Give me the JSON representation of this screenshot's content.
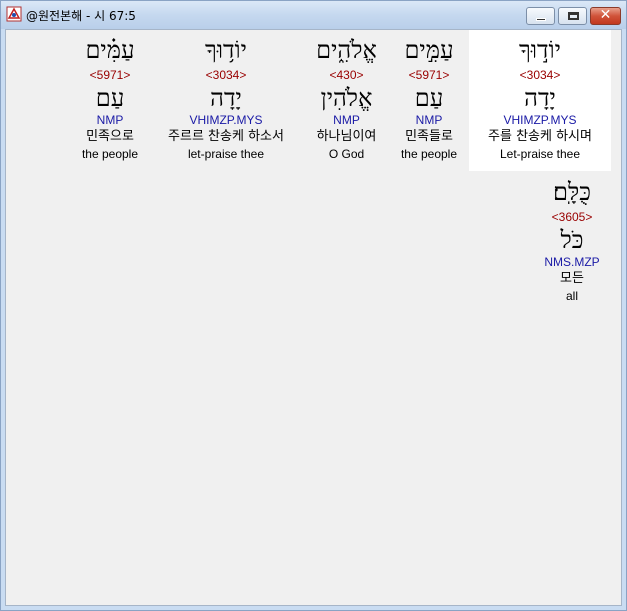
{
  "window": {
    "title": "@원전본해 - 시 67:5",
    "close_glyph": "✕"
  },
  "words": [
    {
      "hebrew": "יוֹד֣וּךָ",
      "strong": "<3034>",
      "lemma": "יָדָה",
      "morph": "VHIMZP.MYS",
      "korean": "주를 찬송케 하시며",
      "english": "Let-praise thee",
      "selected": true
    },
    {
      "hebrew": "עַמִּ֣ים",
      "strong": "<5971>",
      "lemma": "עַם",
      "morph": "NMP",
      "korean": "민족들로",
      "english": "the people",
      "selected": false
    },
    {
      "hebrew": "אֱלֹהִ֑ים",
      "strong": "<430>",
      "lemma": "אֱלֹהִין",
      "morph": "NMP",
      "korean": "하나님이여",
      "english": "O God",
      "selected": false
    },
    {
      "hebrew": "יוֹד֥וּךָ",
      "strong": "<3034>",
      "lemma": "יָדָה",
      "morph": "VHIMZP.MYS",
      "korean": "주르르 찬송케 하소서",
      "english": "let-praise thee",
      "selected": false
    },
    {
      "hebrew": "עַמִּ֗ים",
      "strong": "<5971>",
      "lemma": "עַם",
      "morph": "NMP",
      "korean": "민족으로",
      "english": "the people",
      "selected": false
    },
    {
      "hebrew": "כֻּלָּֽם׃",
      "strong": "<3605>",
      "lemma": "כֹּל",
      "morph": "NMS.MZP",
      "korean": "모든",
      "english": "all",
      "selected": false
    }
  ]
}
